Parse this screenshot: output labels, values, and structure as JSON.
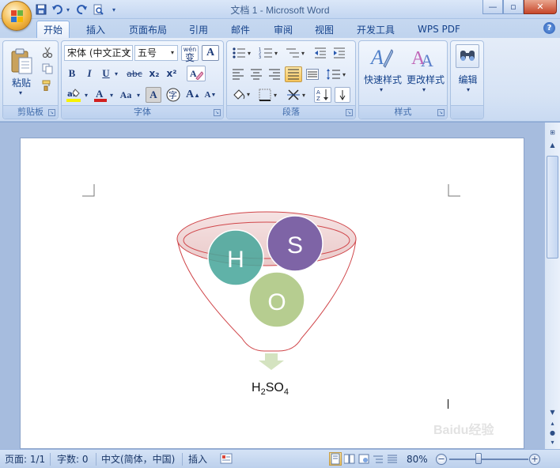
{
  "window": {
    "title": "文档 1 - Microsoft Word",
    "controls": {
      "minimize": "—",
      "maximize": "▫",
      "close": "✕"
    }
  },
  "quick_access": {
    "save_icon": "save-icon",
    "undo_icon": "undo-icon",
    "redo_icon": "redo-icon",
    "print_preview_icon": "print-preview-icon"
  },
  "tabs": [
    {
      "label": "开始",
      "active": true
    },
    {
      "label": "插入"
    },
    {
      "label": "页面布局"
    },
    {
      "label": "引用"
    },
    {
      "label": "邮件"
    },
    {
      "label": "审阅"
    },
    {
      "label": "视图"
    },
    {
      "label": "开发工具"
    },
    {
      "label": "WPS PDF"
    }
  ],
  "help_icon": "?",
  "ribbon": {
    "clipboard": {
      "label": "剪贴板",
      "paste_label": "粘贴"
    },
    "font": {
      "label": "字体",
      "font_name": "宋体 (中文正文",
      "font_size": "五号",
      "bold": "B",
      "italic": "I",
      "underline": "U",
      "strike": "abc",
      "subscript": "x₂",
      "superscript": "x²",
      "grow": "A",
      "shrink": "A",
      "change_case": "Aa",
      "wen": "wén",
      "char_border": "A",
      "char_shade": "A",
      "encircle": "字",
      "font_color_accent": "#d21f1f",
      "highlight_accent": "#f7f200"
    },
    "paragraph": {
      "label": "段落"
    },
    "styles": {
      "label": "样式",
      "quick_styles": "快速样式",
      "change_styles": "更改样式"
    },
    "editing": {
      "label": "编辑"
    }
  },
  "document": {
    "formula": {
      "h": "H",
      "sub2": "2",
      "so": "SO",
      "sub4": "4"
    },
    "smartart": {
      "circles": [
        {
          "label": "H",
          "color": "#4aa79c"
        },
        {
          "label": "S",
          "color": "#7e64a6"
        },
        {
          "label": "O",
          "color": "#b2ca8a"
        }
      ],
      "funnel_stroke": "#d0464a",
      "arrow_color": "#d4e3c0"
    }
  },
  "status": {
    "page": "页面: 1/1",
    "words": "字数: 0",
    "language": "中文(简体，中国)",
    "insert": "插入",
    "zoom": "80%"
  },
  "watermark": "Baidu经验"
}
